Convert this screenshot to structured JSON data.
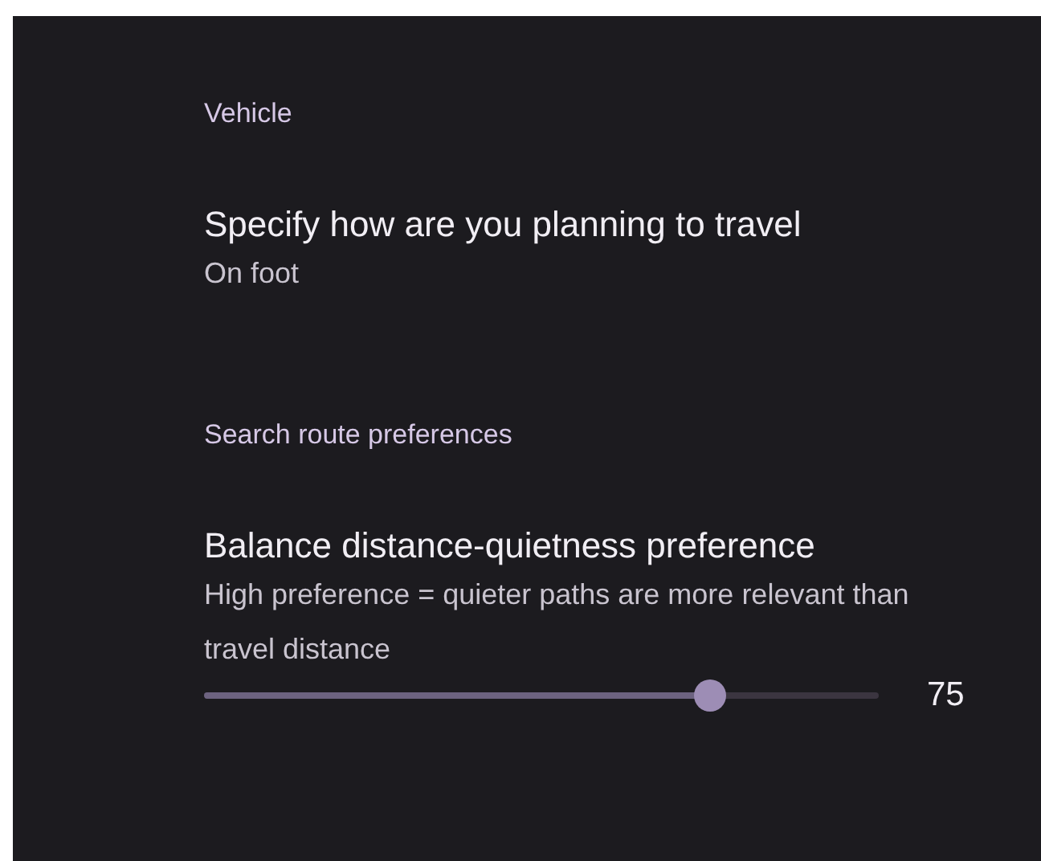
{
  "sections": [
    {
      "category": "Vehicle",
      "items": [
        {
          "kind": "list",
          "title": "Specify how are you planning to travel",
          "summary": "On foot"
        }
      ]
    },
    {
      "category": "Search route preferences",
      "items": [
        {
          "kind": "slider",
          "title": "Balance distance-quietness preference",
          "summary": "High preference = quieter paths are more relevant than travel distance",
          "level": 0.75,
          "reading": "75"
        }
      ]
    }
  ]
}
